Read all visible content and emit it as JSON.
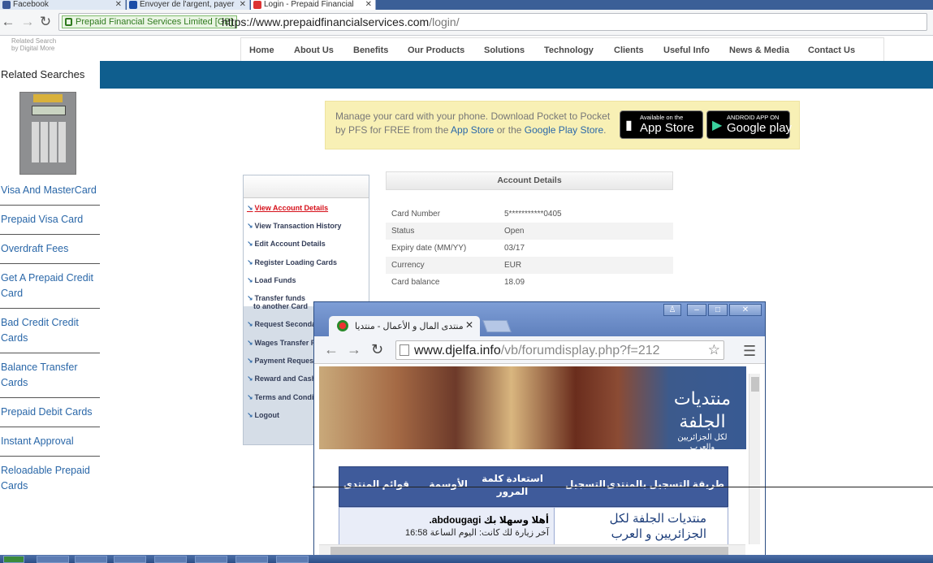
{
  "browser": {
    "tabs": [
      {
        "label": "Facebook",
        "color": "#3b5998"
      },
      {
        "label": "Envoyer de l'argent, payer",
        "color": "#1a4ca8"
      },
      {
        "label": "Login - Prepaid Financial",
        "color": "#d33"
      }
    ],
    "ev_label": "Prepaid Financial Services Limited [GB]",
    "url_main": "https://www.prepaidfinancialservices.com",
    "url_rest": "/login/"
  },
  "sidebar": {
    "note_line1": "Related Search",
    "note_line2": "by Digital More",
    "title": "Related Searches",
    "items": [
      {
        "label": "Visa And MasterCard"
      },
      {
        "label": "Prepaid Visa Card"
      },
      {
        "label": "Overdraft Fees"
      },
      {
        "label": "Get A Prepaid Credit Card"
      },
      {
        "label": "Bad Credit Credit Cards"
      },
      {
        "label": "Balance Transfer Cards"
      },
      {
        "label": "Prepaid Debit Cards"
      },
      {
        "label": "Instant Approval"
      },
      {
        "label": "Reloadable Prepaid Cards"
      }
    ]
  },
  "sitenav": [
    "Home",
    "About Us",
    "Benefits",
    "Our Products",
    "Solutions",
    "Technology",
    "Clients",
    "Useful Info",
    "News & Media",
    "Contact Us"
  ],
  "promo": {
    "text_a": "Manage your card with your phone. Download Pocket to Pocket by PFS for FREE from the ",
    "app_store_link": "App Store",
    "text_b": " or the ",
    "play_link": "Google Play Store",
    "text_c": ".",
    "appstore_small": "Available on the",
    "appstore_big": "App Store",
    "play_small": "ANDROID APP ON",
    "play_big": "Google play"
  },
  "account_menu": [
    {
      "label": "View Account Details",
      "active": true
    },
    {
      "label": "View Transaction History"
    },
    {
      "label": "Edit Account Details"
    },
    {
      "label": "Register Loading Cards"
    },
    {
      "label": "Load Funds"
    },
    {
      "label": "Transfer funds"
    },
    {
      "label": "to another Card"
    },
    {
      "label": "Request Seconda"
    },
    {
      "label": "Wages Transfer F"
    },
    {
      "label": "Payment Request"
    },
    {
      "label": "Reward and Cash"
    },
    {
      "label": "Terms and Condit"
    },
    {
      "label": "Logout"
    }
  ],
  "account_details": {
    "title": "Account Details",
    "rows": [
      {
        "key": "Card Number",
        "value": "5***********0405"
      },
      {
        "key": "Status",
        "value": "Open"
      },
      {
        "key": "Expiry date (MM/YY)",
        "value": "03/17"
      },
      {
        "key": "Currency",
        "value": "EUR"
      },
      {
        "key": "Card balance",
        "value": "18.09"
      }
    ]
  },
  "overlay": {
    "tab_title": "منتدى المال و الأعمال - منتديا",
    "url_main": "www.djelfa.info",
    "url_rest": "/vb/forumdisplay.php?f=212",
    "logo_text": "منتديات الجلفة",
    "logo_sub": "لكل الجزائريين والعرب",
    "forum_nav": [
      "طريقة التسجيل بالمنتدى",
      "التسجيل",
      "استعادة كلمة المرور",
      "الأوسمة",
      "قوائم المنتدى"
    ],
    "forum_site": "منتديات الجلفة لكل الجزائريين و العرب",
    "welcome": "أهلا وسهلا بك abdougagi.",
    "last_visit": "آخر زيارة لك كانت: اليوم الساعة 16:58"
  }
}
